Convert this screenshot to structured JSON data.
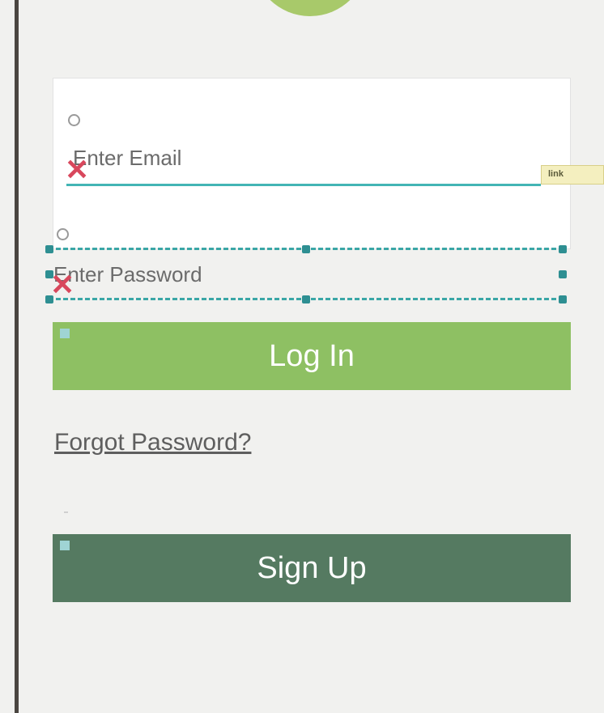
{
  "login_form": {
    "email": {
      "placeholder": "Enter Email"
    },
    "password": {
      "placeholder": "Enter Password"
    },
    "selection_tag": "link"
  },
  "actions": {
    "login_label": "Log In",
    "forgot_label": "Forgot Password?",
    "signup_label": "Sign Up"
  },
  "colors": {
    "login_button": "#8ec063",
    "signup_button": "#557a61",
    "selection": "#3aa6a6",
    "error_mark": "#d8475c",
    "logo": "#a8c96a"
  },
  "icons": [
    "radio-icon",
    "error-x-icon",
    "resize-handle"
  ]
}
